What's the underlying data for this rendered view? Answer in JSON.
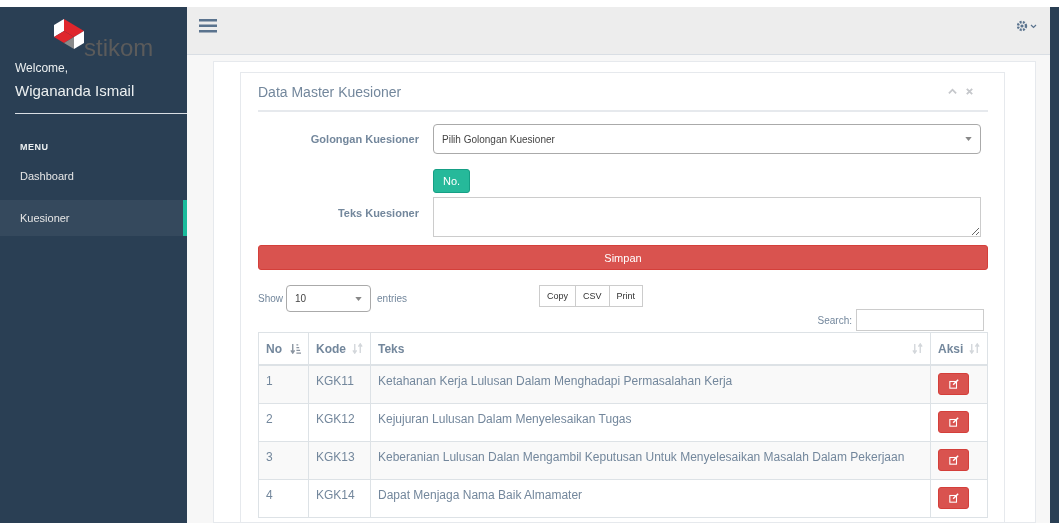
{
  "sidebar": {
    "logo": {
      "name": "stikom"
    },
    "welcome": "Welcome,",
    "user": "Wigananda Ismail",
    "menu_heading": "MENU",
    "items": [
      {
        "label": "Dashboard",
        "selected": false
      },
      {
        "label": "Kuesioner",
        "selected": true
      }
    ]
  },
  "panel": {
    "title": "Data Master Kuesioner",
    "form": {
      "group_label": "Golongan Kuesioner",
      "group_value": "Pilih Golongan Kuesioner",
      "number_button": "No.",
      "text_label": "Teks Kuesioner",
      "save_button": "Simpan"
    },
    "table_controls": {
      "show_label": "Show",
      "page_size": "10",
      "entries_label": "entries",
      "export_buttons": [
        "Copy",
        "CSV",
        "Print"
      ],
      "search_label": "Search:"
    },
    "table": {
      "columns": [
        {
          "label": "No",
          "sorted": true
        },
        {
          "label": "Kode",
          "sorted": false
        },
        {
          "label": "Teks",
          "sorted": false
        },
        {
          "label": "Aksi",
          "sorted": false
        }
      ],
      "rows": [
        {
          "no": "1",
          "kode": "KGK11",
          "teks": "Ketahanan Kerja Lulusan Dalam Menghadapi Permasalahan Kerja"
        },
        {
          "no": "2",
          "kode": "KGK12",
          "teks": "Kejujuran Lulusan Dalam Menyelesaikan Tugas"
        },
        {
          "no": "3",
          "kode": "KGK13",
          "teks": "Keberanian Lulusan Dalan Mengambil Keputusan Untuk Menyelesaikan Masalah Dalam Pekerjaan"
        },
        {
          "no": "4",
          "kode": "KGK14",
          "teks": "Dapat Menjaga Nama Baik Almamater"
        }
      ]
    }
  }
}
